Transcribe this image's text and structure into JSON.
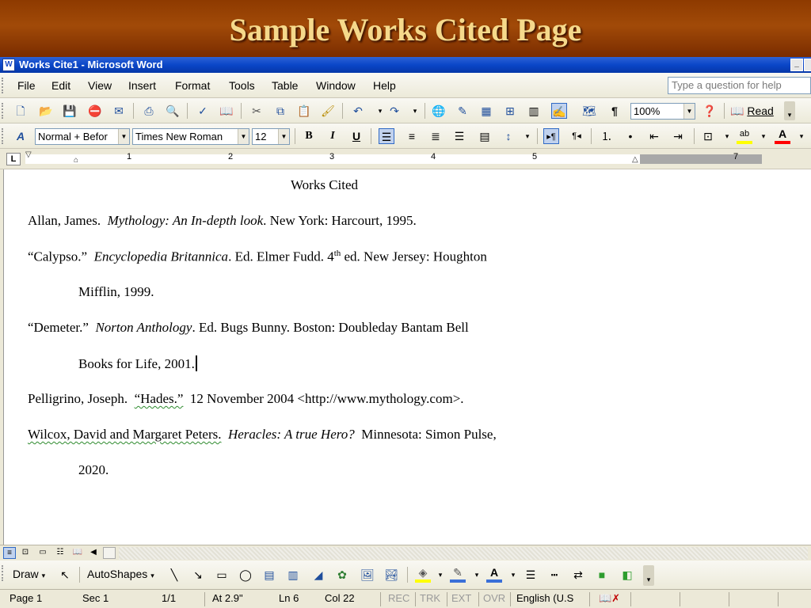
{
  "slide": {
    "title": "Sample Works Cited Page"
  },
  "window": {
    "title": "Works Cite1 - Microsoft Word",
    "min_glyph": "_"
  },
  "menubar": {
    "items": [
      "File",
      "Edit",
      "View",
      "Insert",
      "Format",
      "Tools",
      "Table",
      "Window",
      "Help"
    ],
    "help_placeholder": "Type a question for help"
  },
  "standard_toolbar": {
    "zoom": "100%",
    "read_label": "Read"
  },
  "formatting_toolbar": {
    "style": "Normal + Befor",
    "font": "Times New Roman",
    "size": "12"
  },
  "ruler": {
    "numbers": [
      "1",
      "2",
      "3",
      "4",
      "5",
      "7"
    ]
  },
  "document": {
    "heading": "Works Cited",
    "e1": {
      "a": "Allan, James.",
      "b": "Mythology:  An In-depth look",
      "c": ".  New York:  Harcourt, 1995."
    },
    "e2": {
      "a": "“Calypso.”",
      "b": "Encyclopedia Britannica",
      "c": ".  Ed. Elmer Fudd.  4",
      "sup": "th",
      "d": " ed.  New Jersey:  Houghton",
      "cont": "Mifflin, 1999."
    },
    "e3": {
      "a": "“Demeter.”",
      "b": "Norton Anthology",
      "c": ".  Ed. Bugs Bunny.  Boston:  Doubleday Bantam Bell",
      "cont": "Books for Life, 2001."
    },
    "e4": {
      "a": "Pelligrino, Joseph.",
      "b": "“Hades.”",
      "c": "12 November 2004 <http://www.mythology.com>."
    },
    "e5": {
      "a": "Wilcox, David and Margaret Peters.",
      "b": "Heracles:  A true Hero?",
      "c": "Minnesota:  Simon Pulse,",
      "cont": "2020."
    }
  },
  "drawbar": {
    "draw": "Draw",
    "autoshapes": "AutoShapes"
  },
  "status": {
    "page": "Page  1",
    "sec": "Sec  1",
    "pages": "1/1",
    "at": "At  2.9\"",
    "ln": "Ln  6",
    "col": "Col  22",
    "rec": "REC",
    "trk": "TRK",
    "ext": "EXT",
    "ovr": "OVR",
    "lang": "English (U.S"
  }
}
